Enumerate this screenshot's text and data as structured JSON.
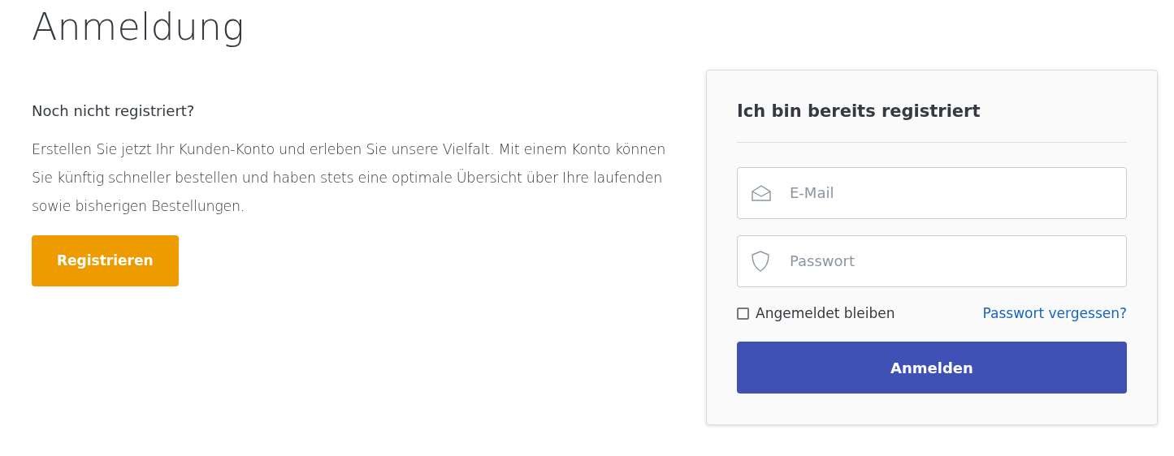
{
  "title": "Anmeldung",
  "register": {
    "heading": "Noch nicht registriert?",
    "text": "Erstellen Sie jetzt Ihr Kunden-Konto und erleben Sie unsere Vielfalt. Mit einem Konto können Sie künftig schneller bestellen und haben stets eine optimale Übersicht über Ihre laufenden sowie bisherigen Bestellungen.",
    "button": "Registrieren"
  },
  "login": {
    "heading": "Ich bin bereits registriert",
    "fields": [
      {
        "kind": "email",
        "placeholder": "E-Mail"
      },
      {
        "kind": "password",
        "placeholder": "Passwort"
      }
    ],
    "remember": {
      "label": "Angemeldet bleiben",
      "checked": false
    },
    "forgot": "Passwort vergessen?",
    "button": "Anmelden"
  }
}
